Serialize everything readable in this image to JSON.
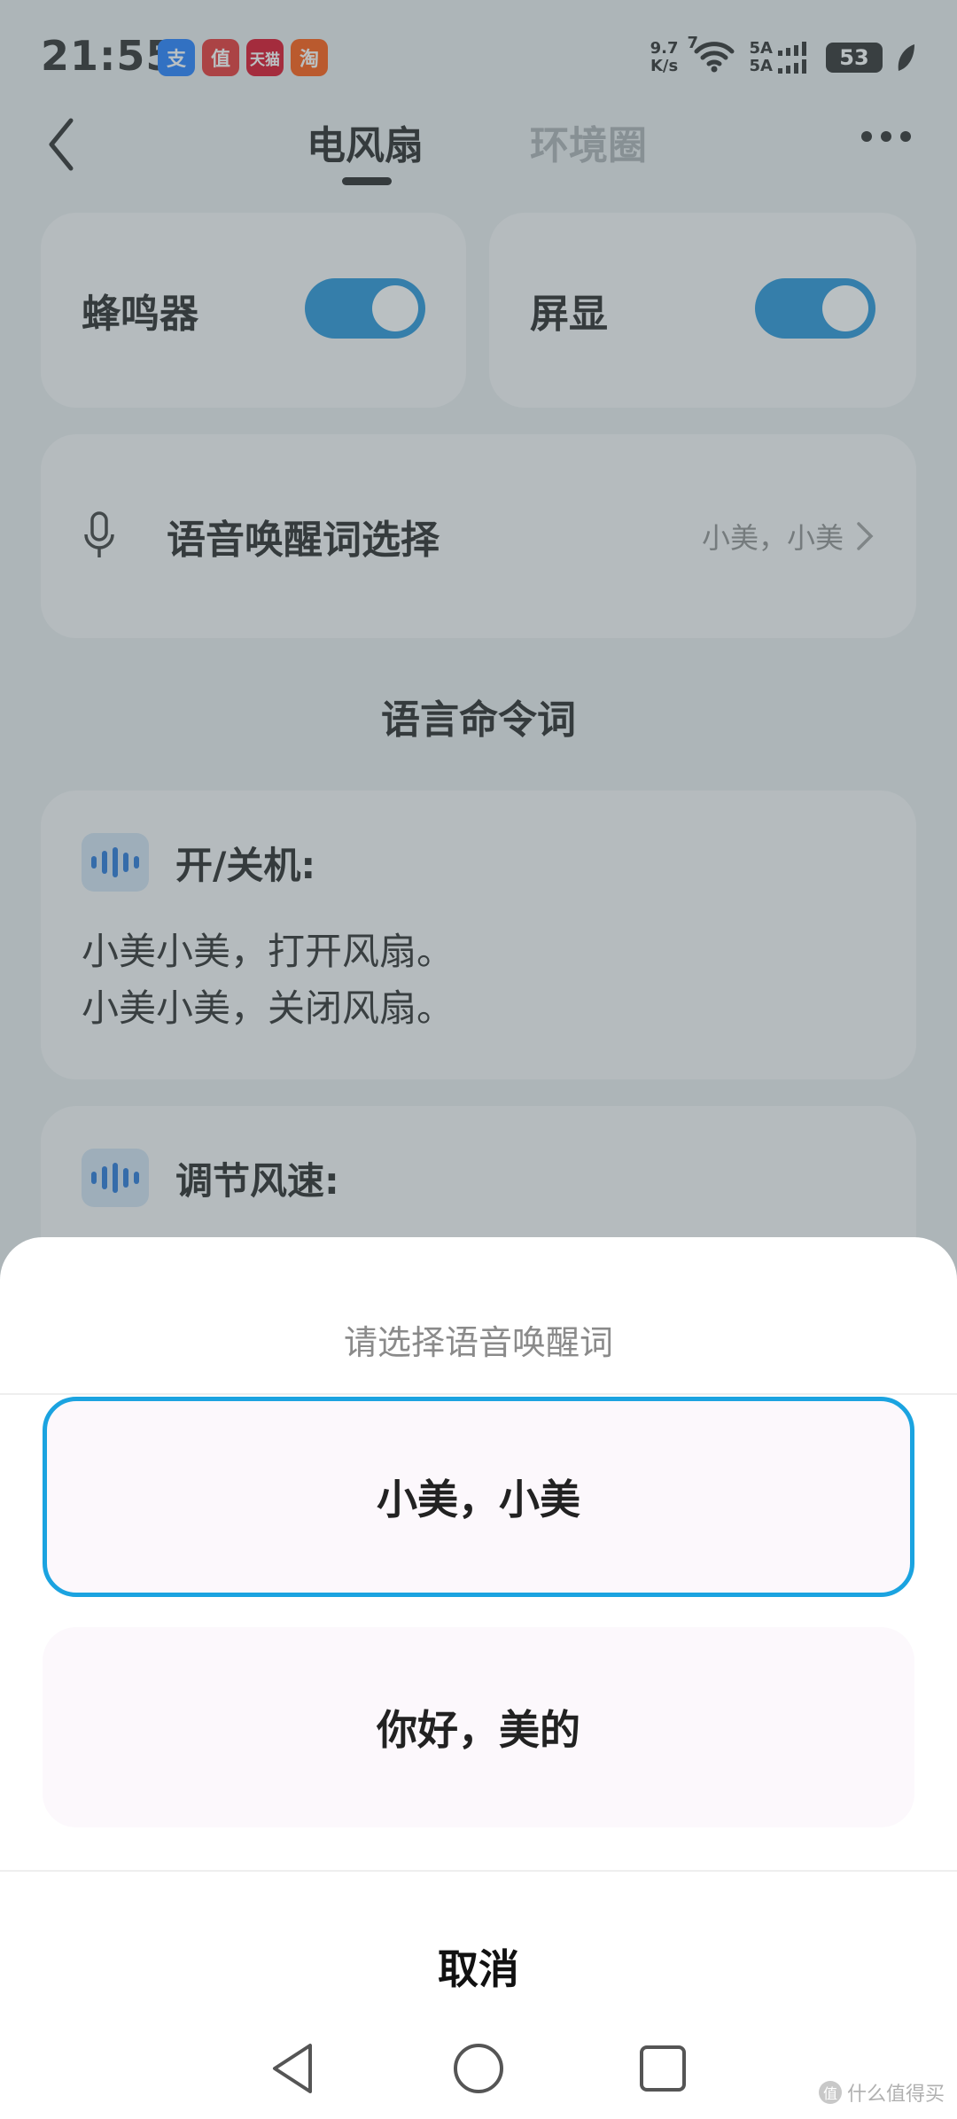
{
  "status_bar": {
    "time": "21:55",
    "apps": [
      {
        "name": "alipay",
        "glyph": "支",
        "color": "#1677ff"
      },
      {
        "name": "smzdm",
        "glyph": "值",
        "color": "#e62828"
      },
      {
        "name": "tmall",
        "glyph": "天猫",
        "color": "#d9001b"
      },
      {
        "name": "taobao",
        "glyph": "淘",
        "color": "#ff5000"
      }
    ],
    "net_speed_value": "9.7",
    "net_speed_unit": "K/s",
    "wifi_badge": "7",
    "signal_1": "5A",
    "signal_2": "5A",
    "battery": "53"
  },
  "nav": {
    "tab_active": "电风扇",
    "tab_inactive": "环境圈"
  },
  "toggles": {
    "buzzer_label": "蜂鸣器",
    "buzzer_on": true,
    "display_label": "屏显",
    "display_on": true
  },
  "voice_wake": {
    "label": "语音唤醒词选择",
    "value": "小美，小美"
  },
  "commands": {
    "section_title": "语言命令词",
    "power": {
      "title": "开/关机:",
      "lines": [
        "小美小美，打开风扇。",
        "小美小美，关闭风扇。"
      ]
    },
    "speed": {
      "title": "调节风速:"
    }
  },
  "sheet": {
    "title": "请选择语音唤醒词",
    "options": [
      "小美，小美",
      "你好，美的"
    ],
    "selected_index": 0,
    "cancel": "取消"
  },
  "watermark": {
    "badge": "值",
    "text": "什么值得买"
  },
  "colors": {
    "accent": "#1a8ed6",
    "selected_border": "#1ba3e0",
    "overlay": "rgba(90,105,110,0.42)"
  }
}
